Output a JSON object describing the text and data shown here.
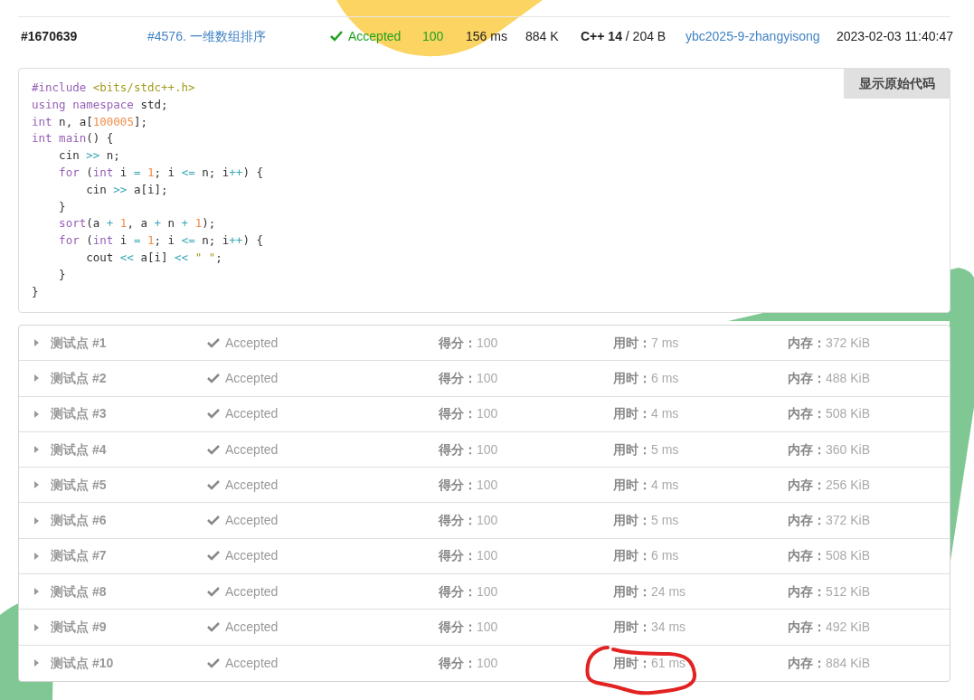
{
  "submission": {
    "id": "#1670639",
    "problem": "#4576. 一维数组排序",
    "status": "Accepted",
    "score": "100",
    "total_time": "156 ms",
    "memory": "884 K",
    "code_file": "**C++ 14** / 204 B",
    "submitter": "ybc2025-9-zhangyisong",
    "submit_time": "2023-02-03 11:40:47"
  },
  "code": {
    "button": "显示原始代码",
    "lines": [
      [
        {
          "text": "#include ",
          "kind": "kw"
        },
        {
          "text": "<bits/stdc++.h>",
          "kind": "str"
        }
      ],
      [
        {
          "text": "using namespace ",
          "kind": "kw"
        },
        {
          "text": "std;",
          "kind": "plain"
        }
      ],
      [
        {
          "text": "int ",
          "kind": "kw"
        },
        {
          "text": "n, a[",
          "kind": "plain"
        },
        {
          "text": "100005",
          "kind": "num"
        },
        {
          "text": "];",
          "kind": "plain"
        }
      ],
      [
        {
          "text": "int ",
          "kind": "kw"
        },
        {
          "text": "main",
          "kind": "kw"
        },
        {
          "text": "() {",
          "kind": "plain"
        }
      ],
      [
        {
          "text": "    cin ",
          "kind": "plain"
        },
        {
          "text": ">>",
          "kind": "op"
        },
        {
          "text": " n;",
          "kind": "plain"
        }
      ],
      [
        {
          "text": "    for ",
          "kind": "kw"
        },
        {
          "text": "(",
          "kind": "plain"
        },
        {
          "text": "int ",
          "kind": "kw"
        },
        {
          "text": "i ",
          "kind": "plain"
        },
        {
          "text": "=",
          "kind": "op"
        },
        {
          "text": " 1",
          "kind": "num"
        },
        {
          "text": "; i ",
          "kind": "plain"
        },
        {
          "text": "<=",
          "kind": "op"
        },
        {
          "text": " n; i",
          "kind": "plain"
        },
        {
          "text": "++",
          "kind": "op"
        },
        {
          "text": ") {",
          "kind": "plain"
        }
      ],
      [
        {
          "text": "        cin ",
          "kind": "plain"
        },
        {
          "text": ">>",
          "kind": "op"
        },
        {
          "text": " a[i];",
          "kind": "plain"
        }
      ],
      [
        {
          "text": "    }",
          "kind": "plain"
        }
      ],
      [
        {
          "text": "    sort",
          "kind": "kw"
        },
        {
          "text": "(a ",
          "kind": "plain"
        },
        {
          "text": "+",
          "kind": "op"
        },
        {
          "text": " 1",
          "kind": "num"
        },
        {
          "text": ", a ",
          "kind": "plain"
        },
        {
          "text": "+",
          "kind": "op"
        },
        {
          "text": " n ",
          "kind": "plain"
        },
        {
          "text": "+",
          "kind": "op"
        },
        {
          "text": " 1",
          "kind": "num"
        },
        {
          "text": ");",
          "kind": "plain"
        }
      ],
      [
        {
          "text": "    for ",
          "kind": "kw"
        },
        {
          "text": "(",
          "kind": "plain"
        },
        {
          "text": "int ",
          "kind": "kw"
        },
        {
          "text": "i ",
          "kind": "plain"
        },
        {
          "text": "=",
          "kind": "op"
        },
        {
          "text": " 1",
          "kind": "num"
        },
        {
          "text": "; i ",
          "kind": "plain"
        },
        {
          "text": "<=",
          "kind": "op"
        },
        {
          "text": " n; i",
          "kind": "plain"
        },
        {
          "text": "++",
          "kind": "op"
        },
        {
          "text": ") {",
          "kind": "plain"
        }
      ],
      [
        {
          "text": "        cout ",
          "kind": "plain"
        },
        {
          "text": "<<",
          "kind": "op"
        },
        {
          "text": " a[i] ",
          "kind": "plain"
        },
        {
          "text": "<<",
          "kind": "op"
        },
        {
          "text": " \" \"",
          "kind": "str"
        },
        {
          "text": ";",
          "kind": "plain"
        }
      ],
      [
        {
          "text": "    }",
          "kind": "plain"
        }
      ],
      [
        {
          "text": "}",
          "kind": "plain"
        }
      ]
    ]
  },
  "tests": [
    {
      "label": "测试点 #1",
      "expanded": false,
      "status": "Accepted",
      "score_label": "得分：",
      "score": "100",
      "time_label": "用时：",
      "time": "7 ms",
      "memory_label": "内存：",
      "memory": "372 KiB"
    },
    {
      "label": "测试点 #2",
      "expanded": false,
      "status": "Accepted",
      "score_label": "得分：",
      "score": "100",
      "time_label": "用时：",
      "time": "6 ms",
      "memory_label": "内存：",
      "memory": "488 KiB"
    },
    {
      "label": "测试点 #3",
      "expanded": false,
      "status": "Accepted",
      "score_label": "得分：",
      "score": "100",
      "time_label": "用时：",
      "time": "4 ms",
      "memory_label": "内存：",
      "memory": "508 KiB"
    },
    {
      "label": "测试点 #4",
      "expanded": false,
      "status": "Accepted",
      "score_label": "得分：",
      "score": "100",
      "time_label": "用时：",
      "time": "5 ms",
      "memory_label": "内存：",
      "memory": "360 KiB"
    },
    {
      "label": "测试点 #5",
      "expanded": false,
      "status": "Accepted",
      "score_label": "得分：",
      "score": "100",
      "time_label": "用时：",
      "time": "4 ms",
      "memory_label": "内存：",
      "memory": "256 KiB"
    },
    {
      "label": "测试点 #6",
      "expanded": false,
      "status": "Accepted",
      "score_label": "得分：",
      "score": "100",
      "time_label": "用时：",
      "time": "5 ms",
      "memory_label": "内存：",
      "memory": "372 KiB"
    },
    {
      "label": "测试点 #7",
      "expanded": false,
      "status": "Accepted",
      "score_label": "得分：",
      "score": "100",
      "time_label": "用时：",
      "time": "6 ms",
      "memory_label": "内存：",
      "memory": "508 KiB"
    },
    {
      "label": "测试点 #8",
      "expanded": false,
      "status": "Accepted",
      "score_label": "得分：",
      "score": "100",
      "time_label": "用时：",
      "time": "24 ms",
      "memory_label": "内存：",
      "memory": "512 KiB"
    },
    {
      "label": "测试点 #9",
      "expanded": false,
      "status": "Accepted",
      "score_label": "得分：",
      "score": "100",
      "time_label": "用时：",
      "time": "34 ms",
      "memory_label": "内存：",
      "memory": "492 KiB"
    },
    {
      "label": "测试点 #10",
      "expanded": false,
      "status": "Accepted",
      "score_label": "得分：",
      "score": "100",
      "time_label": "用时：",
      "time": "61 ms",
      "memory_label": "内存：",
      "memory": "884 KiB"
    }
  ]
}
